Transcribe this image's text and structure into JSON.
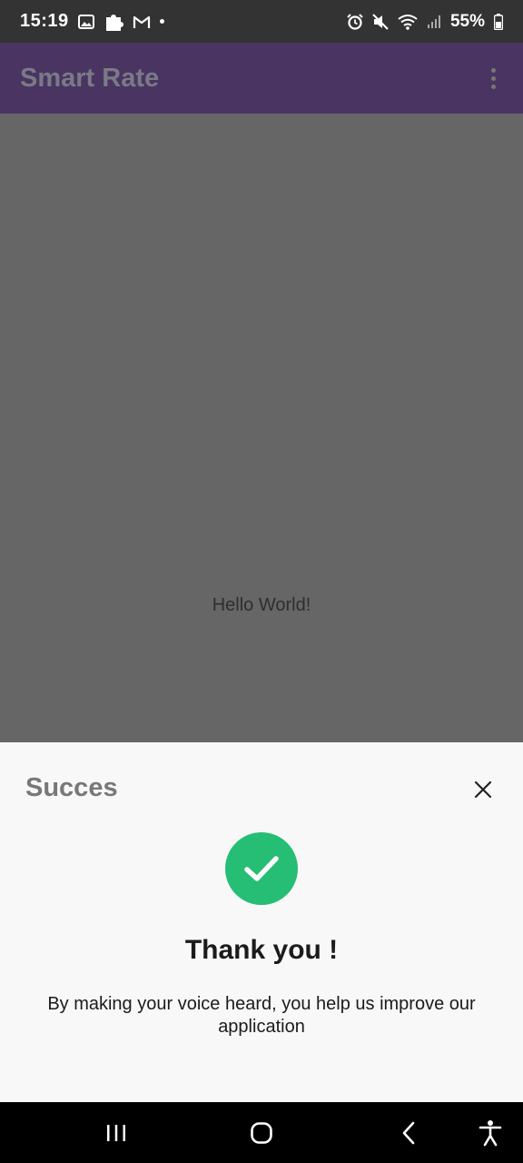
{
  "status_bar": {
    "time": "15:19",
    "battery": "55%",
    "left_icons": [
      "image-icon",
      "puzzle-icon",
      "gmail-icon",
      "notification-dot-icon"
    ],
    "right_icons": [
      "alarm-icon",
      "mute-icon",
      "wifi-icon",
      "signal-icon",
      "battery-icon"
    ]
  },
  "app_bar": {
    "title": "Smart Rate",
    "menu_icon": "overflow-menu-icon"
  },
  "content": {
    "text": "Hello World!"
  },
  "sheet": {
    "title": "Succes",
    "close_icon": "close-icon",
    "success_icon": "check-circle-icon",
    "heading": "Thank you !",
    "message": "By making your voice heard, you help us improve our application"
  },
  "nav_bar": {
    "buttons": [
      "recent-apps-icon",
      "home-icon",
      "back-icon",
      "accessibility-icon"
    ]
  },
  "colors": {
    "status_bar_bg": "#333333",
    "app_bar_bg": "#4a3462",
    "overlay_bg": "#666666",
    "sheet_bg": "#f8f8f8",
    "success_green": "#25be74",
    "nav_bar_bg": "#000000"
  }
}
